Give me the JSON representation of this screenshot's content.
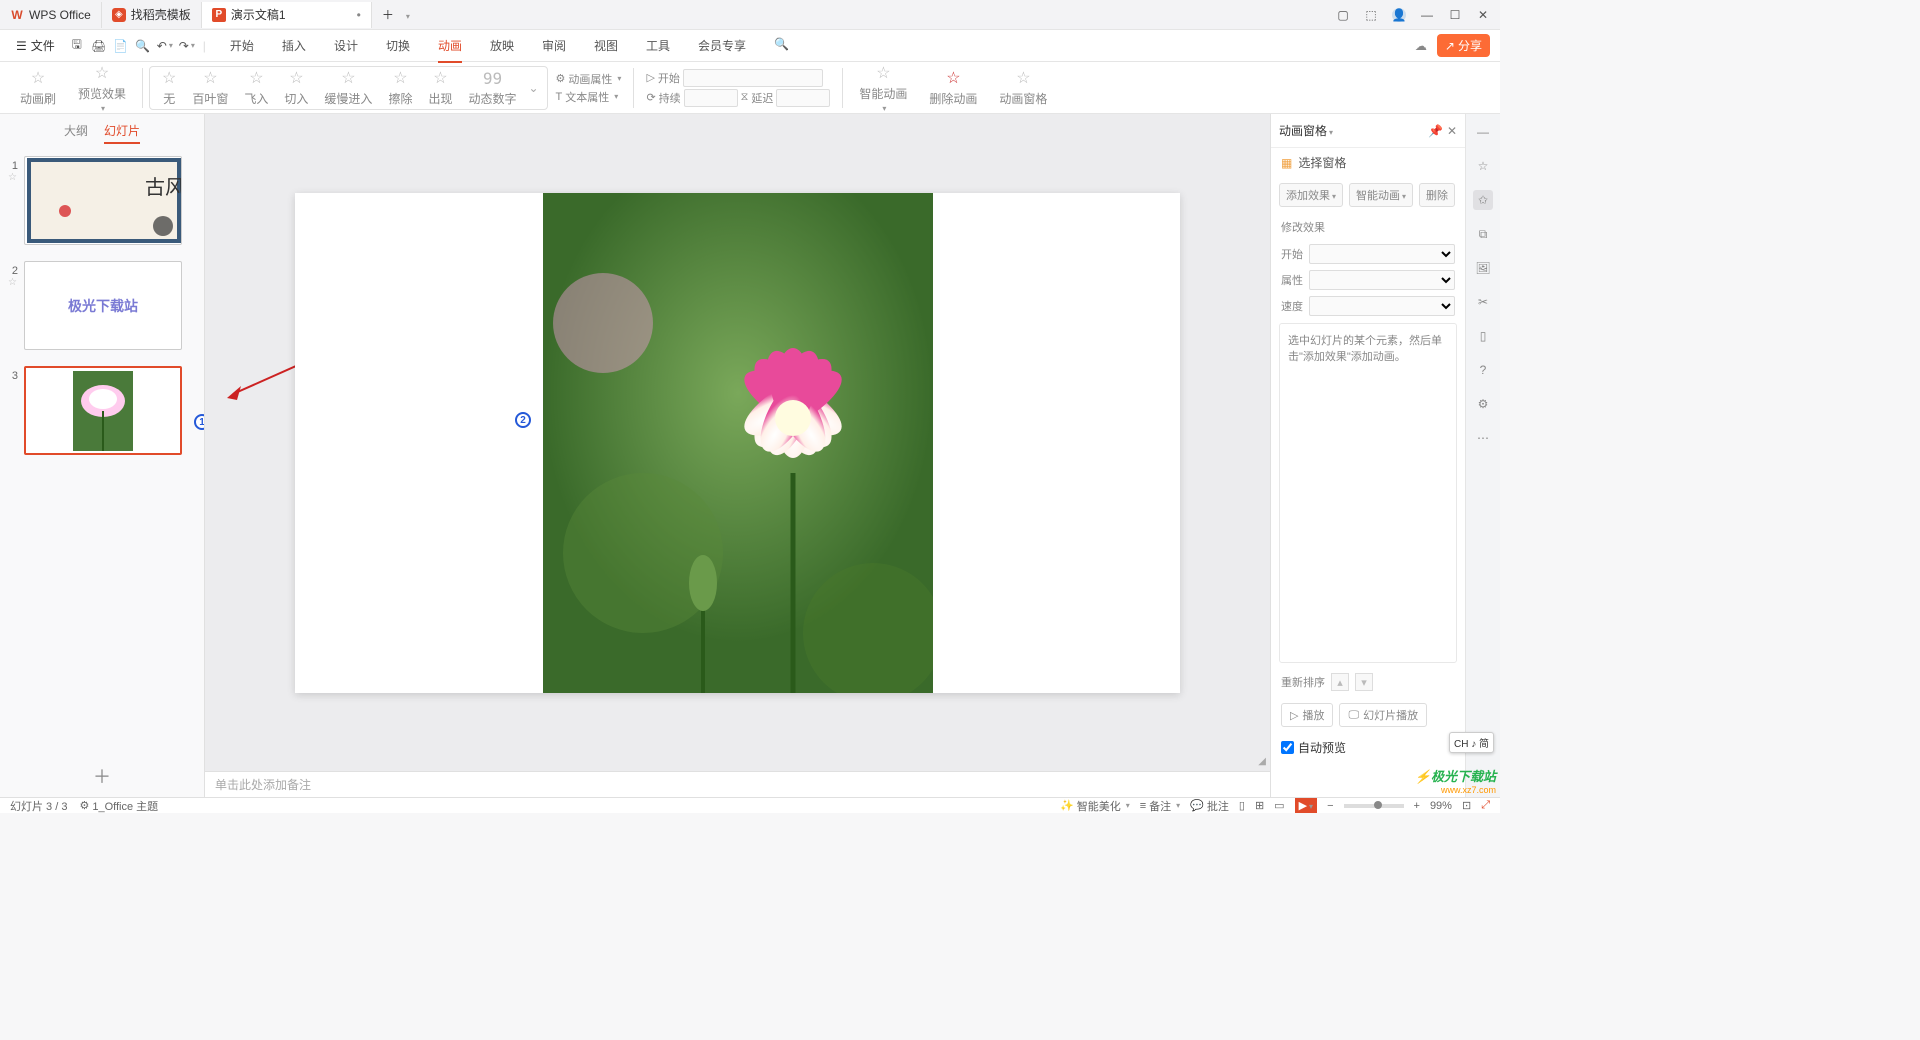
{
  "tabs": {
    "app": "WPS Office",
    "template": "找稻壳模板",
    "doc": "演示文稿1"
  },
  "file_menu": "文件",
  "menus": [
    "开始",
    "插入",
    "设计",
    "切换",
    "动画",
    "放映",
    "审阅",
    "视图",
    "工具",
    "会员专享"
  ],
  "active_menu_index": 4,
  "share": "分享",
  "ribbon": {
    "brush": "动画刷",
    "preview": "预览效果",
    "anims": [
      "无",
      "百叶窗",
      "飞入",
      "切入",
      "缓慢进入",
      "擦除",
      "出现",
      "动态数字"
    ],
    "anim_props": "动画属性",
    "text_props": "文本属性",
    "start": "开始",
    "duration": "持续",
    "delay": "延迟",
    "smart": "智能动画",
    "delete": "删除动画",
    "pane": "动画窗格"
  },
  "panel": {
    "outline": "大纲",
    "slides": "幻灯片",
    "nums": [
      "1",
      "2",
      "3"
    ]
  },
  "slide2_text": "极光下载站",
  "notes_placeholder": "单击此处添加备注",
  "markers": {
    "m1": "1",
    "m2": "2"
  },
  "task_pane": {
    "title": "动画窗格",
    "select": "选择窗格",
    "add_effect": "添加效果",
    "smart_anim": "智能动画",
    "delete": "删除",
    "modify": "修改效果",
    "start": "开始",
    "property": "属性",
    "speed": "速度",
    "hint": "选中幻灯片的某个元素，然后单击\"添加效果\"添加动画。",
    "reorder": "重新排序",
    "play": "播放",
    "slideshow": "幻灯片播放",
    "autoprev": "自动预览"
  },
  "status": {
    "slide": "幻灯片 3 / 3",
    "theme": "1_Office 主题",
    "beautify": "智能美化",
    "notes": "备注",
    "comments": "批注",
    "zoom": "99%"
  },
  "ime": "CH ♪ 简",
  "watermark": {
    "name": "极光下载站",
    "url": "www.xz7.com"
  }
}
